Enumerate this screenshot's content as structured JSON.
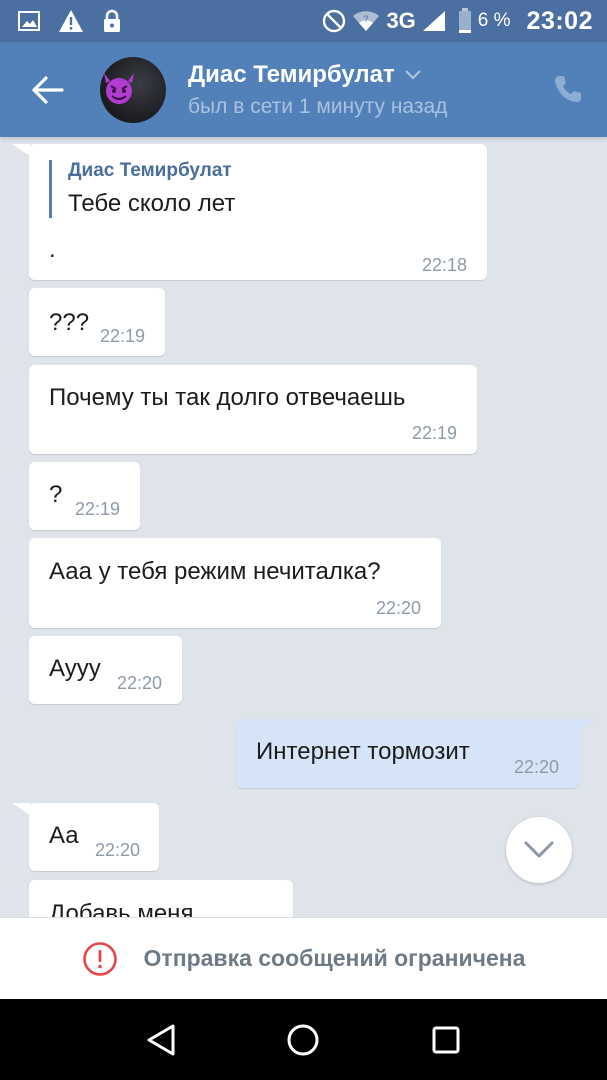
{
  "status_bar": {
    "network": "3G",
    "battery_percent": "6 %",
    "time": "23:02",
    "icons": [
      "image-icon",
      "warning-icon",
      "lock-icon",
      "do-not-disturb-icon",
      "wifi-icon",
      "signal-icon",
      "battery-icon"
    ]
  },
  "header": {
    "title": "Диас Темирбулат",
    "subtitle": "был в сети 1 минуту назад",
    "accent": "#5181b8"
  },
  "messages": [
    {
      "direction": "in",
      "quote_name": "Диас Темирбулат",
      "quote_text": "Тебе сколо лет",
      "text": ".",
      "time": "22:18"
    },
    {
      "direction": "in",
      "text": "???",
      "time": "22:19"
    },
    {
      "direction": "in",
      "text": "Почему ты так долго отвечаешь",
      "time": "22:19"
    },
    {
      "direction": "in",
      "text": "?",
      "time": "22:19"
    },
    {
      "direction": "in",
      "text": "Ааа у тебя режим нечиталка?",
      "time": "22:20"
    },
    {
      "direction": "in",
      "text": "Аууу",
      "time": "22:20"
    },
    {
      "direction": "out",
      "text": "Интернет тормозит",
      "time": "22:20"
    },
    {
      "direction": "in",
      "text": "Аа",
      "time": "22:20"
    },
    {
      "direction": "in",
      "text": "Добавь меня",
      "time": ""
    }
  ],
  "restriction": {
    "text": "Отправка сообщений ограничена",
    "color": "#e64646"
  }
}
